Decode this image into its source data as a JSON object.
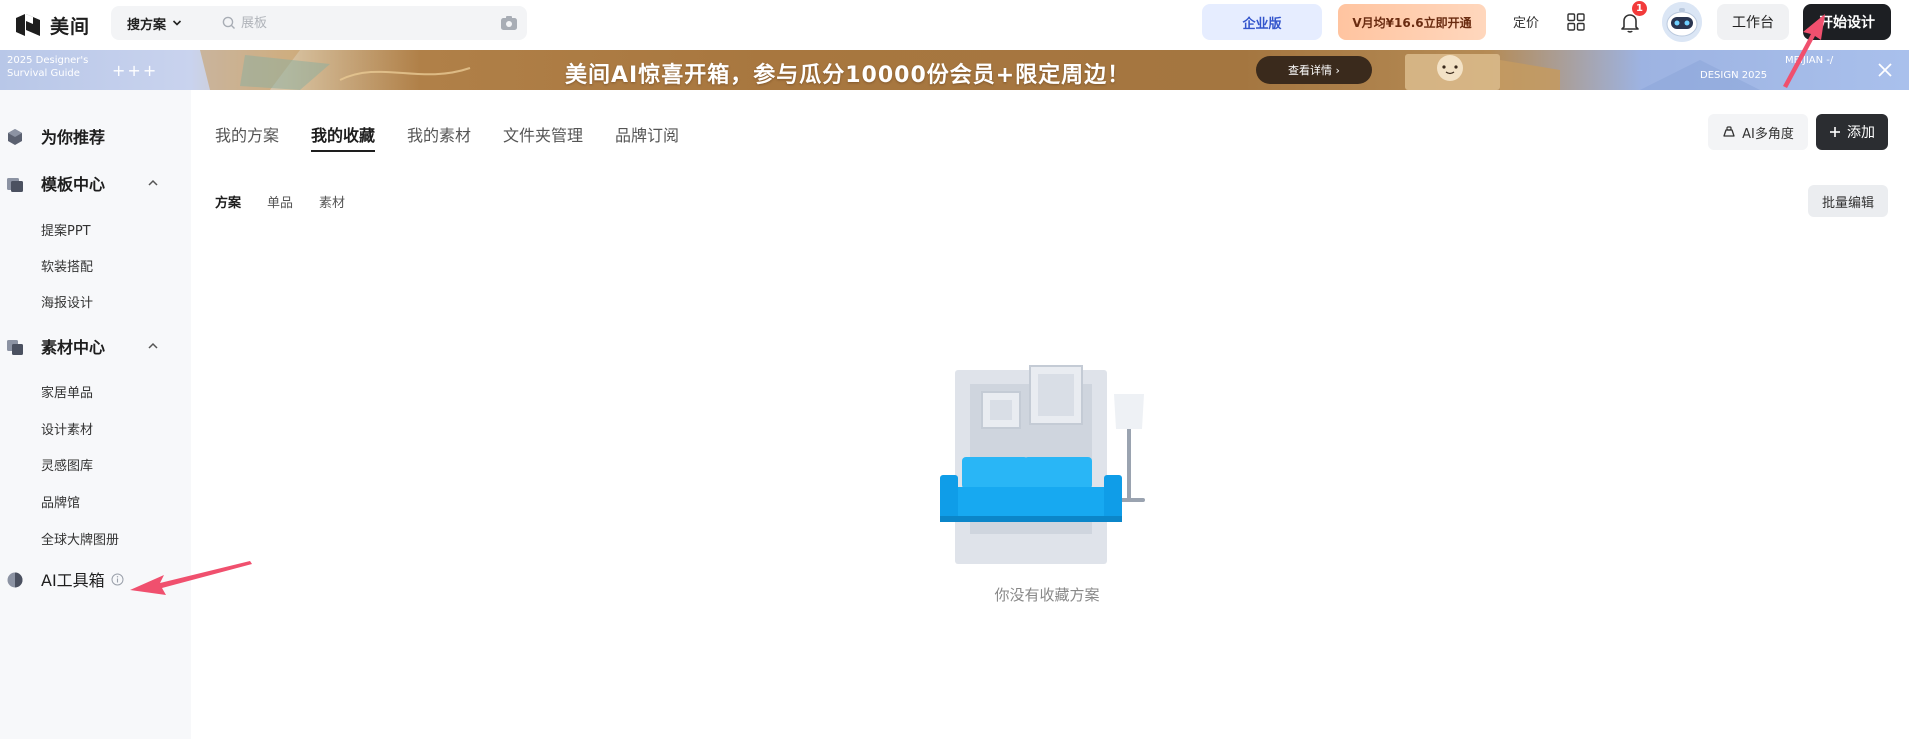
{
  "app": {
    "logo_text": "美间"
  },
  "header": {
    "search_type": "搜方案",
    "search_placeholder": "展板",
    "enterprise_label": "企业版",
    "vip_label": "V月均¥16.6立即开通",
    "pricing_label": "定价",
    "notification_count": "1",
    "workbench_label": "工作台",
    "start_design_label": "开始设计"
  },
  "banner": {
    "left_line1": "2025 Designer's",
    "left_line2": "Survival Guide",
    "plus_marks": "+++",
    "title": "美间AI惊喜开箱，参与瓜分10000份会员+限定周边！",
    "details_button": "查看详情 ›",
    "right_text": "DESIGN 2025",
    "right_text2": "MEIJIAN -/"
  },
  "sidebar": {
    "recommend": "为你推荐",
    "template_center": "模板中心",
    "template_items": [
      "提案PPT",
      "软装搭配",
      "海报设计"
    ],
    "material_center": "素材中心",
    "material_items": [
      "家居单品",
      "设计素材",
      "灵感图库",
      "品牌馆",
      "全球大牌图册"
    ],
    "ai_toolbox": "AI工具箱"
  },
  "main": {
    "tabs": [
      "我的方案",
      "我的收藏",
      "我的素材",
      "文件夹管理",
      "品牌订阅"
    ],
    "active_tab": "我的收藏",
    "ai_multi_angle": "AI多角度",
    "add_label": "添加",
    "subtabs": [
      "方案",
      "单品",
      "素材"
    ],
    "active_subtab": "方案",
    "batch_edit": "批量编辑",
    "empty_text": "你没有收藏方案"
  },
  "colors": {
    "primary_dark": "#1d1f23",
    "enterprise_bg": "#e6edff",
    "vip_bg": "#ffc4a0",
    "sofa_blue": "#1aa7ec",
    "annotation_red": "#f0506e"
  }
}
